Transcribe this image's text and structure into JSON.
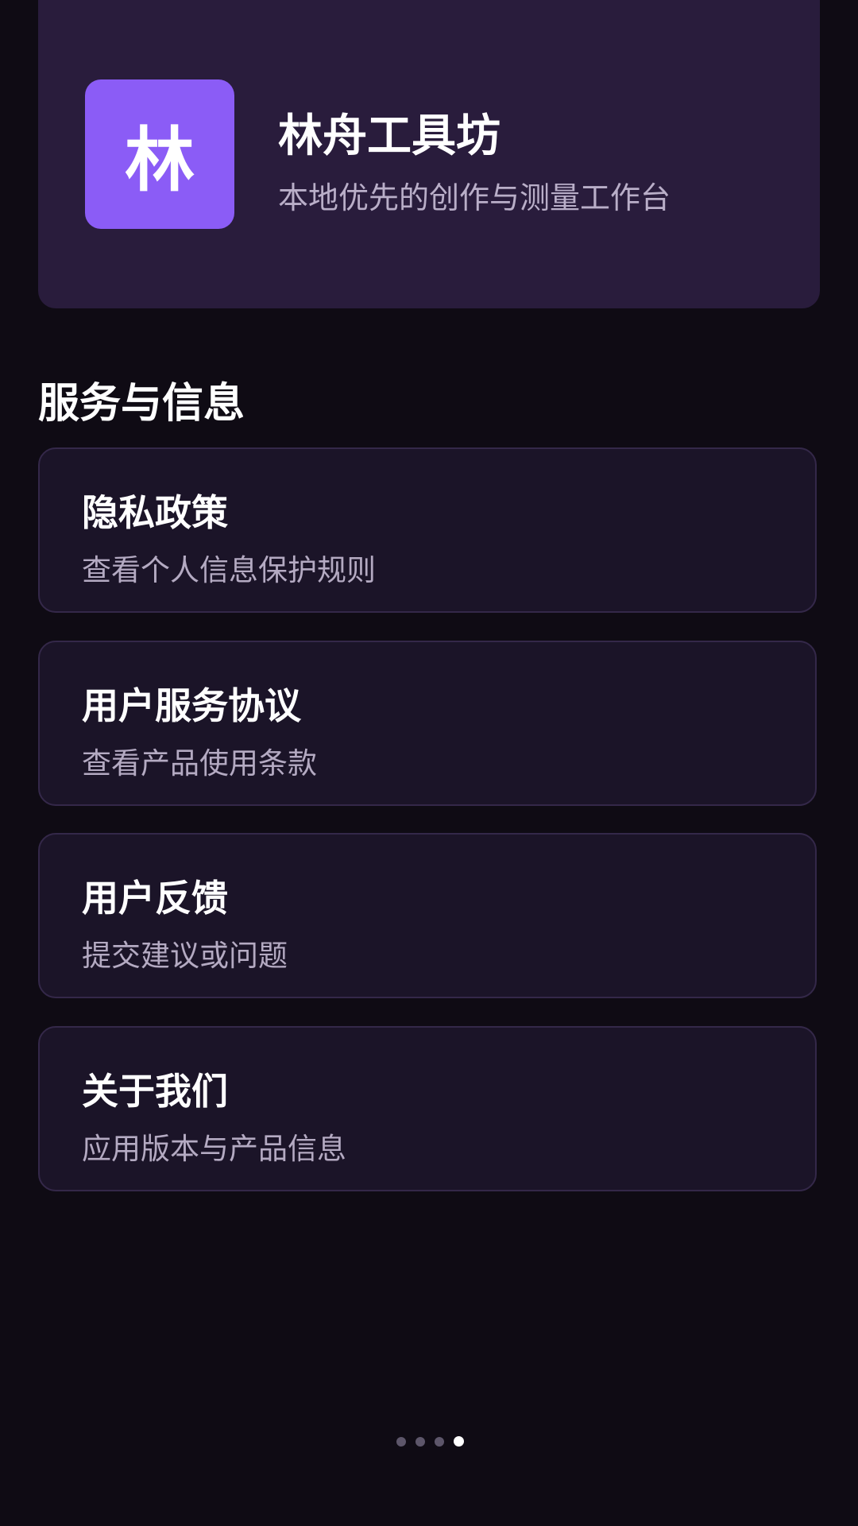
{
  "header": {
    "logo_text": "林",
    "app_name": "林舟工具坊",
    "tagline": "本地优先的创作与测量工作台"
  },
  "section": {
    "title": "服务与信息"
  },
  "menu": [
    {
      "title": "隐私政策",
      "subtitle": "查看个人信息保护规则"
    },
    {
      "title": "用户服务协议",
      "subtitle": "查看产品使用条款"
    },
    {
      "title": "用户反馈",
      "subtitle": "提交建议或问题"
    },
    {
      "title": "关于我们",
      "subtitle": "应用版本与产品信息"
    }
  ],
  "pager": {
    "total": 4,
    "current": 4
  },
  "colors": {
    "background": "#0f0b14",
    "header_card": "#291c3c",
    "accent": "#8b5cf6",
    "card": "#1b1428",
    "card_border": "#342849"
  }
}
